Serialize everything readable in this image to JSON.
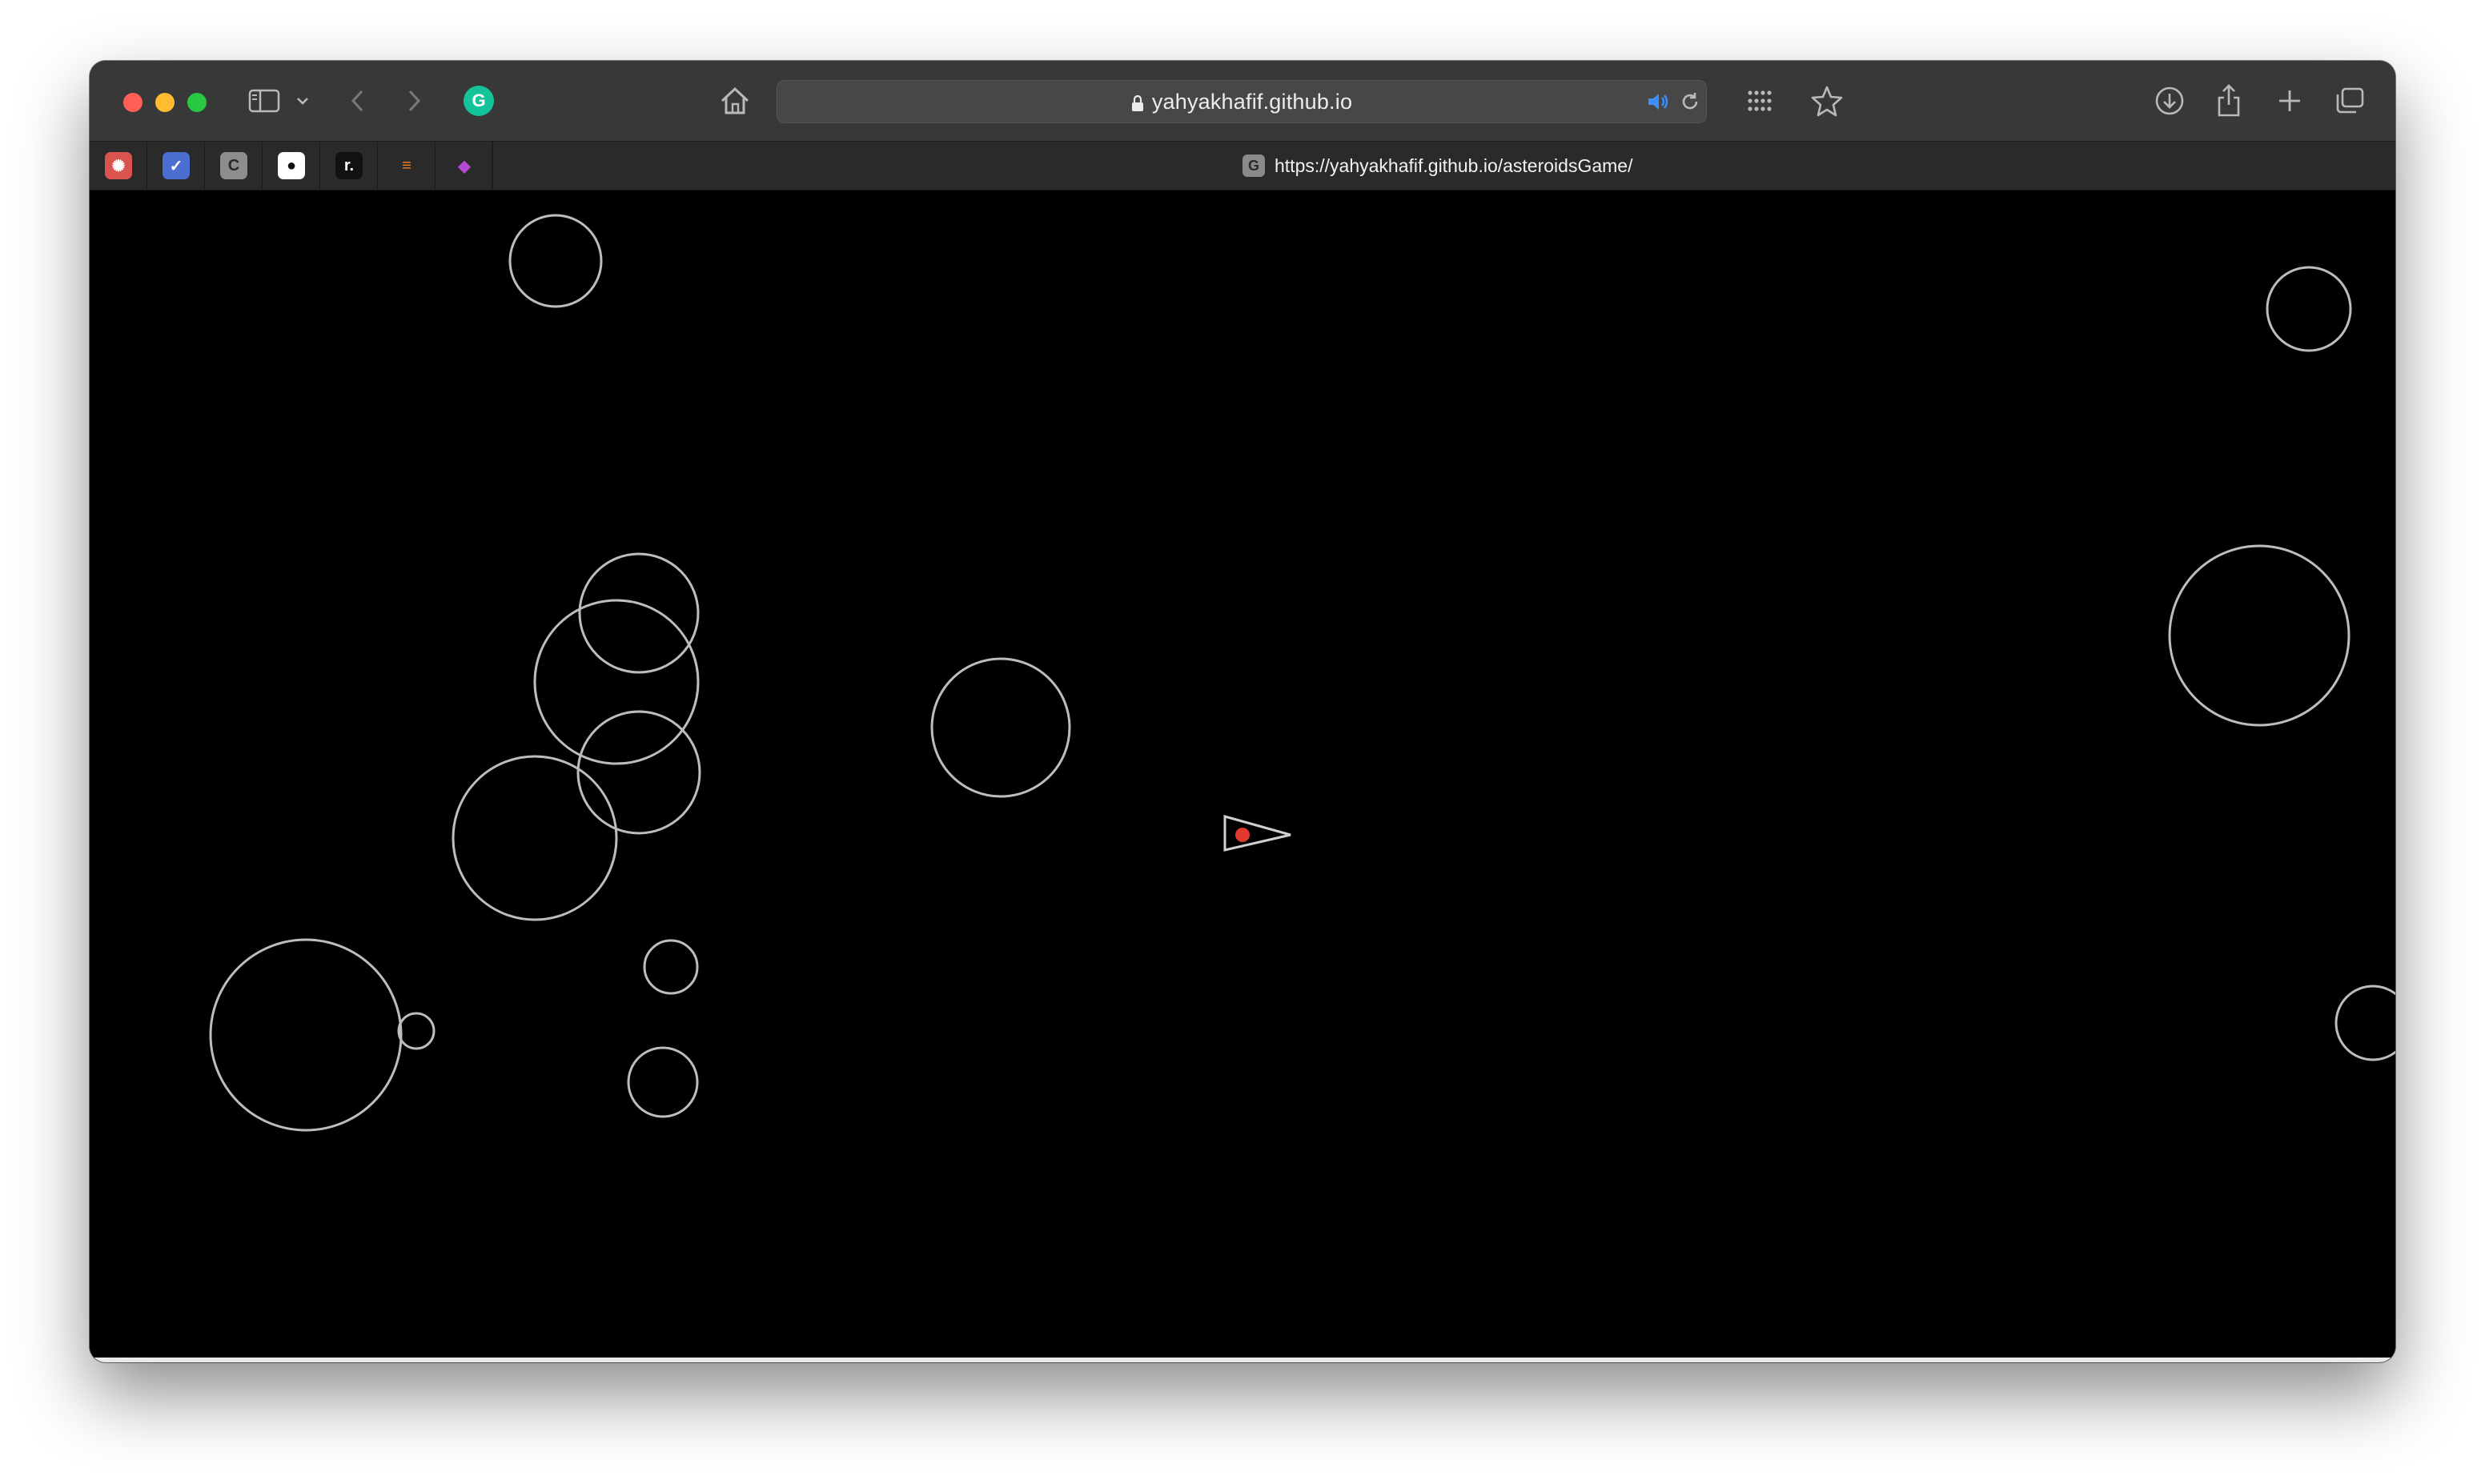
{
  "browser": {
    "address_host": "yahyakhafif.github.io",
    "active_tab_url": "https://yahyakhafif.github.io/asteroidsGame/",
    "active_tab_favicon_letter": "G",
    "toolbar_icons": [
      "sidebar-icon",
      "chevron-down-icon",
      "back-icon",
      "forward-icon",
      "grammarly-icon",
      "home-icon",
      "lock-icon",
      "speaker-icon",
      "reload-icon",
      "grid-icon",
      "star-icon",
      "download-icon",
      "share-icon",
      "plus-icon",
      "tabs-overview-icon"
    ],
    "pinned_tabs": [
      {
        "name": "pinned-tab-openai",
        "glyph": "✺",
        "bg": "#d9534f",
        "fg": "#ffffff"
      },
      {
        "name": "pinned-tab-mail",
        "glyph": "✓",
        "bg": "#4a6fd1",
        "fg": "#ffffff"
      },
      {
        "name": "pinned-tab-c",
        "glyph": "C",
        "bg": "#8d8d8d",
        "fg": "#2a2a2a"
      },
      {
        "name": "pinned-tab-github",
        "glyph": "●",
        "bg": "#ffffff",
        "fg": "#111111"
      },
      {
        "name": "pinned-tab-r",
        "glyph": "r.",
        "bg": "#111111",
        "fg": "#ffffff"
      },
      {
        "name": "pinned-tab-stackoverflow",
        "glyph": "≡",
        "bg": "#2a2a2a",
        "fg": "#f48024"
      },
      {
        "name": "pinned-tab-app",
        "glyph": "◆",
        "bg": "#2a2a2a",
        "fg": "#b24bd1"
      }
    ]
  },
  "colors": {
    "toolbar": "#383838",
    "tabbar": "#2a2a2a",
    "game_background": "#000000",
    "asteroid_stroke": "#bdbdbd",
    "ship_stroke": "#d0d0d0",
    "ship_core": "#e03a2e",
    "grammarly_green": "#15c39a",
    "speaker_blue": "#3d8ef7"
  }
}
